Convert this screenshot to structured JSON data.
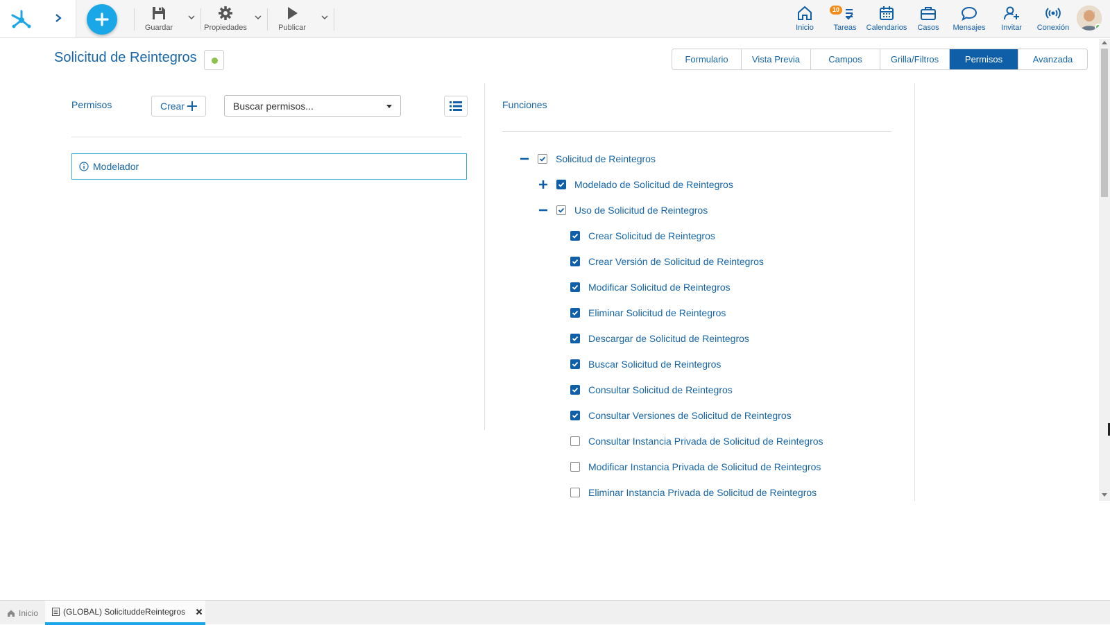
{
  "toolbar": {
    "save_label": "Guardar",
    "properties_label": "Propiedades",
    "publish_label": "Publicar"
  },
  "nav": {
    "home_label": "Inicio",
    "tasks_label": "Tareas",
    "tasks_badge": "10",
    "calendars_label": "Calendarios",
    "cases_label": "Casos",
    "messages_label": "Mensajes",
    "invite_label": "Invitar",
    "connection_label": "Conexión"
  },
  "page": {
    "title": "Solicitud de Reintegros"
  },
  "tabs": [
    {
      "label": "Formulario",
      "active": false
    },
    {
      "label": "Vista Previa",
      "active": false
    },
    {
      "label": "Campos",
      "active": false
    },
    {
      "label": "Grilla/Filtros",
      "active": false
    },
    {
      "label": "Permisos",
      "active": true
    },
    {
      "label": "Avanzada",
      "active": false
    }
  ],
  "permissions": {
    "heading": "Permisos",
    "create_label": "Crear",
    "search_placeholder": "Buscar permisos...",
    "items": [
      {
        "label": "Modelador"
      }
    ]
  },
  "functions": {
    "heading": "Funciones",
    "tree": [
      {
        "label": "Solicitud de Reintegros",
        "level": 0,
        "toggle": "minus",
        "checked": true,
        "style": "outline"
      },
      {
        "label": "Modelado de Solicitud de Reintegros",
        "level": 1,
        "toggle": "plus",
        "checked": true,
        "style": "filled"
      },
      {
        "label": "Uso de Solicitud de Reintegros",
        "level": 1,
        "toggle": "minus",
        "checked": true,
        "style": "outline"
      },
      {
        "label": "Crear Solicitud de Reintegros",
        "level": 2,
        "checked": true,
        "style": "filled"
      },
      {
        "label": "Crear Versión de Solicitud de Reintegros",
        "level": 2,
        "checked": true,
        "style": "filled"
      },
      {
        "label": "Modificar Solicitud de Reintegros",
        "level": 2,
        "checked": true,
        "style": "filled"
      },
      {
        "label": "Eliminar Solicitud de Reintegros",
        "level": 2,
        "checked": true,
        "style": "filled"
      },
      {
        "label": "Descargar de Solicitud de Reintegros",
        "level": 2,
        "checked": true,
        "style": "filled"
      },
      {
        "label": "Buscar Solicitud de Reintegros",
        "level": 2,
        "checked": true,
        "style": "filled"
      },
      {
        "label": "Consultar Solicitud de Reintegros",
        "level": 2,
        "checked": true,
        "style": "filled"
      },
      {
        "label": "Consultar Versiones de Solicitud de Reintegros",
        "level": 2,
        "checked": true,
        "style": "filled"
      },
      {
        "label": "Consultar Instancia Privada de Solicitud de Reintegros",
        "level": 2,
        "checked": false,
        "style": "empty"
      },
      {
        "label": "Modificar Instancia Privada de Solicitud de Reintegros",
        "level": 2,
        "checked": false,
        "style": "empty"
      },
      {
        "label": "Eliminar Instancia Privada de Solicitud de Reintegros",
        "level": 2,
        "checked": false,
        "style": "empty"
      }
    ]
  },
  "bottom_tabs": [
    {
      "label": "Inicio",
      "icon": "home-icon",
      "active": false
    },
    {
      "label": "(GLOBAL) SolicituddeReintegros",
      "icon": "form-icon",
      "active": true
    }
  ],
  "colors": {
    "primary": "#0f5ea8",
    "accent": "#1aa7e8",
    "badge": "#f28c1b",
    "status_ok": "#8bc34a"
  }
}
